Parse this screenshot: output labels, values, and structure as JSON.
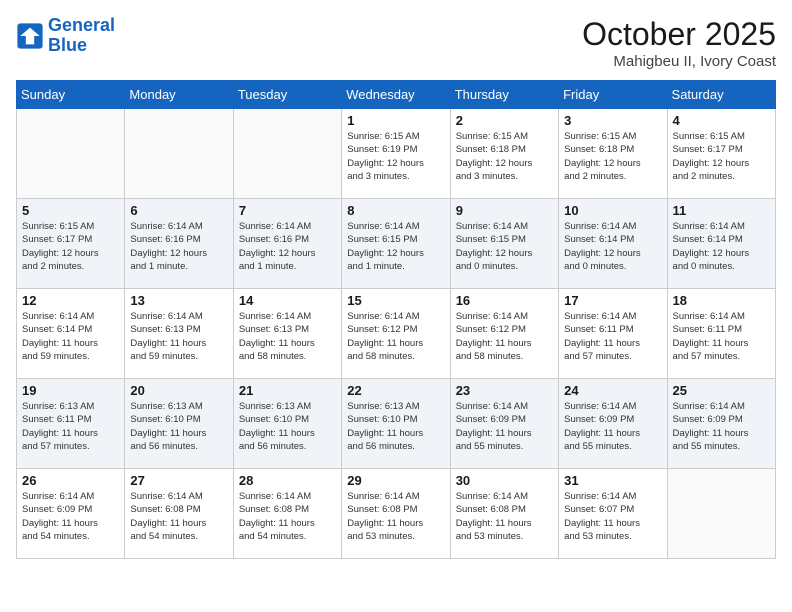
{
  "header": {
    "logo_line1": "General",
    "logo_line2": "Blue",
    "month": "October 2025",
    "location": "Mahigbeu II, Ivory Coast"
  },
  "days_of_week": [
    "Sunday",
    "Monday",
    "Tuesday",
    "Wednesday",
    "Thursday",
    "Friday",
    "Saturday"
  ],
  "weeks": [
    [
      {
        "day": "",
        "info": ""
      },
      {
        "day": "",
        "info": ""
      },
      {
        "day": "",
        "info": ""
      },
      {
        "day": "1",
        "info": "Sunrise: 6:15 AM\nSunset: 6:19 PM\nDaylight: 12 hours\nand 3 minutes."
      },
      {
        "day": "2",
        "info": "Sunrise: 6:15 AM\nSunset: 6:18 PM\nDaylight: 12 hours\nand 3 minutes."
      },
      {
        "day": "3",
        "info": "Sunrise: 6:15 AM\nSunset: 6:18 PM\nDaylight: 12 hours\nand 2 minutes."
      },
      {
        "day": "4",
        "info": "Sunrise: 6:15 AM\nSunset: 6:17 PM\nDaylight: 12 hours\nand 2 minutes."
      }
    ],
    [
      {
        "day": "5",
        "info": "Sunrise: 6:15 AM\nSunset: 6:17 PM\nDaylight: 12 hours\nand 2 minutes."
      },
      {
        "day": "6",
        "info": "Sunrise: 6:14 AM\nSunset: 6:16 PM\nDaylight: 12 hours\nand 1 minute."
      },
      {
        "day": "7",
        "info": "Sunrise: 6:14 AM\nSunset: 6:16 PM\nDaylight: 12 hours\nand 1 minute."
      },
      {
        "day": "8",
        "info": "Sunrise: 6:14 AM\nSunset: 6:15 PM\nDaylight: 12 hours\nand 1 minute."
      },
      {
        "day": "9",
        "info": "Sunrise: 6:14 AM\nSunset: 6:15 PM\nDaylight: 12 hours\nand 0 minutes."
      },
      {
        "day": "10",
        "info": "Sunrise: 6:14 AM\nSunset: 6:14 PM\nDaylight: 12 hours\nand 0 minutes."
      },
      {
        "day": "11",
        "info": "Sunrise: 6:14 AM\nSunset: 6:14 PM\nDaylight: 12 hours\nand 0 minutes."
      }
    ],
    [
      {
        "day": "12",
        "info": "Sunrise: 6:14 AM\nSunset: 6:14 PM\nDaylight: 11 hours\nand 59 minutes."
      },
      {
        "day": "13",
        "info": "Sunrise: 6:14 AM\nSunset: 6:13 PM\nDaylight: 11 hours\nand 59 minutes."
      },
      {
        "day": "14",
        "info": "Sunrise: 6:14 AM\nSunset: 6:13 PM\nDaylight: 11 hours\nand 58 minutes."
      },
      {
        "day": "15",
        "info": "Sunrise: 6:14 AM\nSunset: 6:12 PM\nDaylight: 11 hours\nand 58 minutes."
      },
      {
        "day": "16",
        "info": "Sunrise: 6:14 AM\nSunset: 6:12 PM\nDaylight: 11 hours\nand 58 minutes."
      },
      {
        "day": "17",
        "info": "Sunrise: 6:14 AM\nSunset: 6:11 PM\nDaylight: 11 hours\nand 57 minutes."
      },
      {
        "day": "18",
        "info": "Sunrise: 6:14 AM\nSunset: 6:11 PM\nDaylight: 11 hours\nand 57 minutes."
      }
    ],
    [
      {
        "day": "19",
        "info": "Sunrise: 6:13 AM\nSunset: 6:11 PM\nDaylight: 11 hours\nand 57 minutes."
      },
      {
        "day": "20",
        "info": "Sunrise: 6:13 AM\nSunset: 6:10 PM\nDaylight: 11 hours\nand 56 minutes."
      },
      {
        "day": "21",
        "info": "Sunrise: 6:13 AM\nSunset: 6:10 PM\nDaylight: 11 hours\nand 56 minutes."
      },
      {
        "day": "22",
        "info": "Sunrise: 6:13 AM\nSunset: 6:10 PM\nDaylight: 11 hours\nand 56 minutes."
      },
      {
        "day": "23",
        "info": "Sunrise: 6:14 AM\nSunset: 6:09 PM\nDaylight: 11 hours\nand 55 minutes."
      },
      {
        "day": "24",
        "info": "Sunrise: 6:14 AM\nSunset: 6:09 PM\nDaylight: 11 hours\nand 55 minutes."
      },
      {
        "day": "25",
        "info": "Sunrise: 6:14 AM\nSunset: 6:09 PM\nDaylight: 11 hours\nand 55 minutes."
      }
    ],
    [
      {
        "day": "26",
        "info": "Sunrise: 6:14 AM\nSunset: 6:09 PM\nDaylight: 11 hours\nand 54 minutes."
      },
      {
        "day": "27",
        "info": "Sunrise: 6:14 AM\nSunset: 6:08 PM\nDaylight: 11 hours\nand 54 minutes."
      },
      {
        "day": "28",
        "info": "Sunrise: 6:14 AM\nSunset: 6:08 PM\nDaylight: 11 hours\nand 54 minutes."
      },
      {
        "day": "29",
        "info": "Sunrise: 6:14 AM\nSunset: 6:08 PM\nDaylight: 11 hours\nand 53 minutes."
      },
      {
        "day": "30",
        "info": "Sunrise: 6:14 AM\nSunset: 6:08 PM\nDaylight: 11 hours\nand 53 minutes."
      },
      {
        "day": "31",
        "info": "Sunrise: 6:14 AM\nSunset: 6:07 PM\nDaylight: 11 hours\nand 53 minutes."
      },
      {
        "day": "",
        "info": ""
      }
    ]
  ]
}
